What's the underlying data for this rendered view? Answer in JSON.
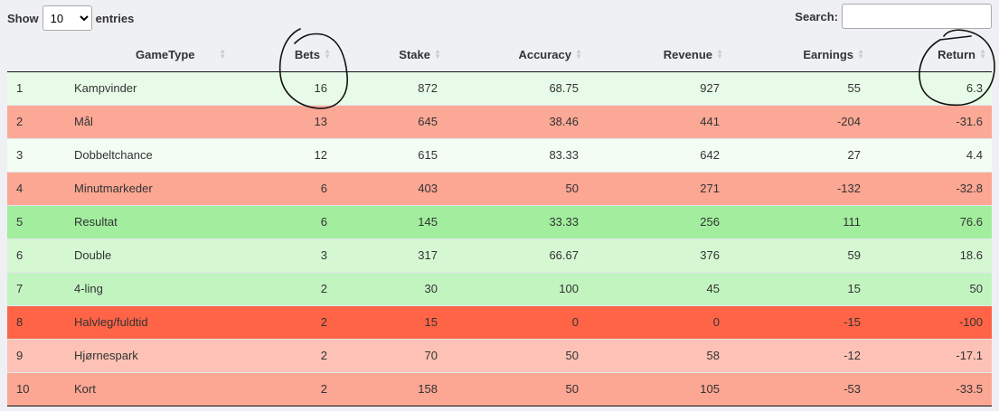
{
  "controls": {
    "show_label": "Show",
    "entries_label": "entries",
    "page_length": "10",
    "search_label": "Search:",
    "search_value": ""
  },
  "table": {
    "columns": [
      "",
      "GameType",
      "Bets",
      "Stake",
      "Accuracy",
      "Revenue",
      "Earnings",
      "Return"
    ],
    "rows": [
      {
        "idx": "1",
        "game": "Kampvinder",
        "bets": "16",
        "stake": "872",
        "accuracy": "68.75",
        "revenue": "927",
        "earnings": "55",
        "return": "6.3",
        "bg": "#e8fbe8"
      },
      {
        "idx": "2",
        "game": "Mål",
        "bets": "13",
        "stake": "645",
        "accuracy": "38.46",
        "revenue": "441",
        "earnings": "-204",
        "return": "-31.6",
        "bg": "#fca896"
      },
      {
        "idx": "3",
        "game": "Dobbeltchance",
        "bets": "12",
        "stake": "615",
        "accuracy": "83.33",
        "revenue": "642",
        "earnings": "27",
        "return": "4.4",
        "bg": "#f3fdf3"
      },
      {
        "idx": "4",
        "game": "Minutmarkeder",
        "bets": "6",
        "stake": "403",
        "accuracy": "50",
        "revenue": "271",
        "earnings": "-132",
        "return": "-32.8",
        "bg": "#fca694"
      },
      {
        "idx": "5",
        "game": "Resultat",
        "bets": "6",
        "stake": "145",
        "accuracy": "33.33",
        "revenue": "256",
        "earnings": "111",
        "return": "76.6",
        "bg": "#a2ee9e"
      },
      {
        "idx": "6",
        "game": "Double",
        "bets": "3",
        "stake": "317",
        "accuracy": "66.67",
        "revenue": "376",
        "earnings": "59",
        "return": "18.6",
        "bg": "#d5f8d3"
      },
      {
        "idx": "7",
        "game": "4-ling",
        "bets": "2",
        "stake": "30",
        "accuracy": "100",
        "revenue": "45",
        "earnings": "15",
        "return": "50",
        "bg": "#c2f4c0"
      },
      {
        "idx": "8",
        "game": "Halvleg/fuldtid",
        "bets": "2",
        "stake": "15",
        "accuracy": "0",
        "revenue": "0",
        "earnings": "-15",
        "return": "-100",
        "bg": "#ff6447"
      },
      {
        "idx": "9",
        "game": "Hjørnespark",
        "bets": "2",
        "stake": "70",
        "accuracy": "50",
        "revenue": "58",
        "earnings": "-12",
        "return": "-17.1",
        "bg": "#fdc2b5"
      },
      {
        "idx": "10",
        "game": "Kort",
        "bets": "2",
        "stake": "158",
        "accuracy": "50",
        "revenue": "105",
        "earnings": "-53",
        "return": "-33.5",
        "bg": "#fca694"
      }
    ]
  },
  "colors": {
    "background": "#eef0f3",
    "annotation_ink": "#111111"
  }
}
